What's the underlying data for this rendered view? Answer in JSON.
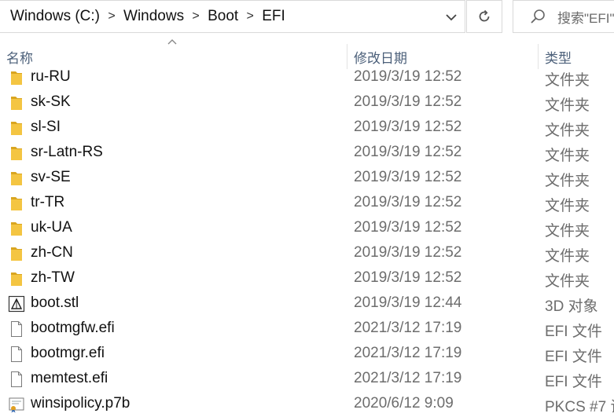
{
  "address_bar": {
    "crumbs": [
      "Windows (C:)",
      "Windows",
      "Boot",
      "EFI"
    ],
    "separator": ">"
  },
  "search": {
    "placeholder": "搜索\"EFI\""
  },
  "columns": {
    "name": "名称",
    "date": "修改日期",
    "type": "类型"
  },
  "files": [
    {
      "name": "ru-RU",
      "date": "2019/3/19 12:52",
      "type": "文件夹",
      "icon": "folder-icon"
    },
    {
      "name": "sk-SK",
      "date": "2019/3/19 12:52",
      "type": "文件夹",
      "icon": "folder-icon"
    },
    {
      "name": "sl-SI",
      "date": "2019/3/19 12:52",
      "type": "文件夹",
      "icon": "folder-icon"
    },
    {
      "name": "sr-Latn-RS",
      "date": "2019/3/19 12:52",
      "type": "文件夹",
      "icon": "folder-icon"
    },
    {
      "name": "sv-SE",
      "date": "2019/3/19 12:52",
      "type": "文件夹",
      "icon": "folder-icon"
    },
    {
      "name": "tr-TR",
      "date": "2019/3/19 12:52",
      "type": "文件夹",
      "icon": "folder-icon"
    },
    {
      "name": "uk-UA",
      "date": "2019/3/19 12:52",
      "type": "文件夹",
      "icon": "folder-icon"
    },
    {
      "name": "zh-CN",
      "date": "2019/3/19 12:52",
      "type": "文件夹",
      "icon": "folder-icon"
    },
    {
      "name": "zh-TW",
      "date": "2019/3/19 12:52",
      "type": "文件夹",
      "icon": "folder-icon"
    },
    {
      "name": "boot.stl",
      "date": "2019/3/19 12:44",
      "type": "3D 对象",
      "icon": "3d-object-icon"
    },
    {
      "name": "bootmgfw.efi",
      "date": "2021/3/12 17:19",
      "type": "EFI 文件",
      "icon": "file-icon"
    },
    {
      "name": "bootmgr.efi",
      "date": "2021/3/12 17:19",
      "type": "EFI 文件",
      "icon": "file-icon"
    },
    {
      "name": "memtest.efi",
      "date": "2021/3/12 17:19",
      "type": "EFI 文件",
      "icon": "file-icon"
    },
    {
      "name": "winsipolicy.p7b",
      "date": "2020/6/12 9:09",
      "type": "PKCS #7 证",
      "icon": "certificate-icon"
    }
  ],
  "colors": {
    "folder": "#f4c542",
    "header_text": "#4c607a",
    "secondary_text": "#6d6d6d"
  }
}
